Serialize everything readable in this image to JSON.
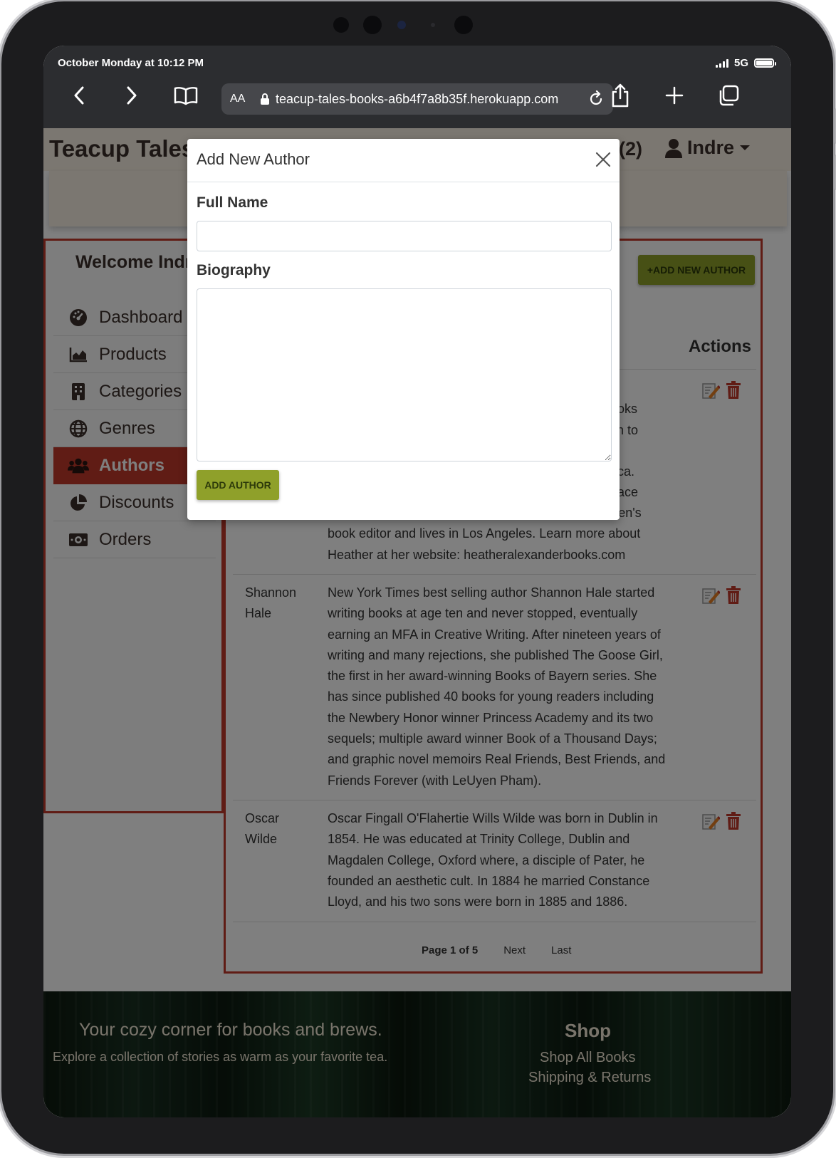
{
  "status_bar": {
    "time": "October Monday at 10:12 PM",
    "network": "5G"
  },
  "browser": {
    "aa_label": "AA",
    "url": "teacup-tales-books-a6b4f7a8b35f.herokuapp.com"
  },
  "navbar": {
    "brand": "Teacup Tales B",
    "bag_count": "(2)",
    "user": "Indre"
  },
  "sidebar": {
    "welcome": "Welcome Indre",
    "items": [
      {
        "label": "Dashboard",
        "icon": "gauge-icon"
      },
      {
        "label": "Products",
        "icon": "chart-area-icon"
      },
      {
        "label": "Categories",
        "icon": "building-icon"
      },
      {
        "label": "Genres",
        "icon": "globe-icon"
      },
      {
        "label": "Authors",
        "icon": "users-icon",
        "active": true
      },
      {
        "label": "Discounts",
        "icon": "pie-chart-icon"
      },
      {
        "label": "Orders",
        "icon": "money-bill-icon"
      }
    ]
  },
  "authors_page": {
    "add_button": "+ADD NEW AUTHOR",
    "actions_header": "Actions",
    "rows": [
      {
        "name": "",
        "bio_visible_fragments": [
          "r",
          "books",
          "tion to",
          ", A",
          "erica.",
          "Grace"
        ],
        "bio": "Take the Case and Eat Bugs. She is a former children's book editor and lives in Los Angeles. Learn more about Heather at her website: heatheralexanderbooks.com"
      },
      {
        "name": "Shannon Hale",
        "bio": "New York Times best selling author Shannon Hale started writing books at age ten and never stopped, eventually earning an MFA in Creative Writing. After nineteen years of writing and many rejections, she published The Goose Girl, the first in her award-winning Books of Bayern series. She has since published 40 books for young readers including the Newbery Honor winner Princess Academy and its two sequels; multiple award winner Book of a Thousand Days; and graphic novel memoirs Real Friends, Best Friends, and Friends Forever (with LeUyen Pham)."
      },
      {
        "name": "Oscar Wilde",
        "bio": "Oscar Fingall O'Flahertie Wills Wilde was born in Dublin in 1854. He was educated at Trinity College, Dublin and Magdalen College, Oxford where, a disciple of Pater, he founded an aesthetic cult. In 1884 he married Constance Lloyd, and his two sons were born in 1885 and 1886."
      }
    ],
    "pagination": {
      "current": "Page 1 of 5",
      "next": "Next",
      "last": "Last"
    }
  },
  "footer": {
    "tagline": "Your cozy corner for books and brews.",
    "subtitle": "Explore a collection of stories as warm as your favorite tea.",
    "shop_heading": "Shop",
    "shop_all": "Shop All Books",
    "shipping": "Shipping & Returns"
  },
  "modal": {
    "title": "Add New Author",
    "full_name_label": "Full Name",
    "full_name_value": "",
    "biography_label": "Biography",
    "biography_value": "",
    "submit_label": "ADD AUTHOR"
  },
  "colors": {
    "accent_red": "#c0392b",
    "button_olive": "#8fa02a",
    "navbar_cream": "#f7efe2",
    "chrome_dark": "#2c2d30",
    "edit_icon": "#e67e22",
    "delete_icon": "#c0392b"
  }
}
